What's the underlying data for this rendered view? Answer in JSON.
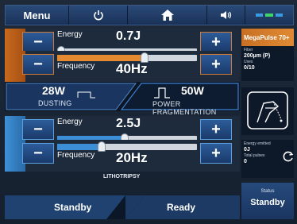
{
  "topbar": {
    "menu_label": "Menu",
    "icons": [
      "power-icon",
      "home-icon",
      "volume-icon",
      "status-indicator-icon"
    ],
    "indicator_colors": [
      "#3a9adf",
      "#3fd46a",
      "#3a9adf"
    ]
  },
  "dusting": {
    "energy": {
      "label": "Energy",
      "value": "0.7J",
      "level": 0.0
    },
    "frequency": {
      "label": "Frequency",
      "value": "40Hz",
      "level": 0.63
    },
    "accent": "#c86a1e"
  },
  "modes": {
    "left": {
      "watts": "28W",
      "name": "DUSTING"
    },
    "right": {
      "watts": "50W",
      "name": "POWER FRAGMENTATION"
    }
  },
  "lithotripsy": {
    "energy": {
      "label": "Energy",
      "value": "2.5J",
      "level": 0.48
    },
    "frequency": {
      "label": "Frequency",
      "value": "20Hz",
      "level": 0.31
    },
    "name": "LITHOTRIPSY",
    "accent": "#3e90d6"
  },
  "bottom": {
    "standby_label": "Standby",
    "ready_label": "Ready"
  },
  "device": {
    "name": "MegaPulse 70+",
    "fiber_label": "Fiber",
    "fiber_value": "200µm (P)",
    "uses_label": "Uses",
    "uses_value": "0/10",
    "energy_label": "Energy emitted",
    "energy_value": "0J",
    "pulses_label": "Total pulses",
    "pulses_value": "0"
  },
  "status": {
    "label": "Status",
    "value": "Standby"
  }
}
